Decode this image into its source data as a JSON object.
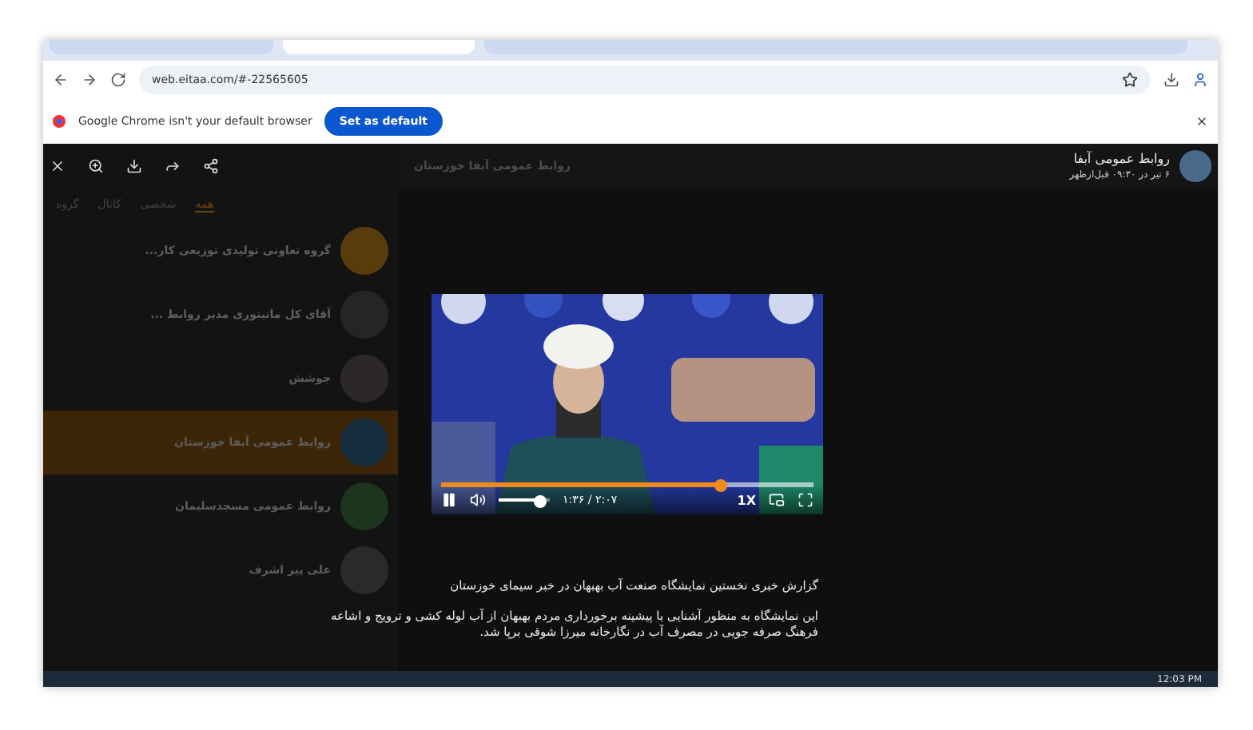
{
  "browser": {
    "tabs": [
      {
        "selected": false
      },
      {
        "selected": true
      },
      {
        "selected": false
      }
    ],
    "url": "web.eitaa.com/#-22565605",
    "banner": {
      "text": "Google Chrome isn't your default browser",
      "button": "Set as default"
    }
  },
  "sidebar": {
    "filters": [
      {
        "label": "همه",
        "selected": true
      },
      {
        "label": "شخصی",
        "selected": false
      },
      {
        "label": "کانال",
        "selected": false
      },
      {
        "label": "گروه",
        "selected": false
      }
    ],
    "chats": [
      {
        "name": "گروه تعاونی تولیدی توزیعی کار...",
        "selected": false
      },
      {
        "name": "آقای کل مانیتوری مدیر روابط ...",
        "selected": false
      },
      {
        "name": "جوشش",
        "selected": false
      },
      {
        "name": "روابط عمومی آبفا خوزستان",
        "selected": true
      },
      {
        "name": "روابط عمومی مسجدسلیمان",
        "selected": false
      },
      {
        "name": "علی پیر اشرف",
        "selected": false
      }
    ]
  },
  "chat": {
    "title": "روابط عمومی آبفا خوزستان"
  },
  "viewer": {
    "author": "روابط عمومی آبفا",
    "date": "۶ تیر در ۰۹:۳۰ قبل‌ازظهر",
    "video": {
      "kind": "picture",
      "playing": true,
      "level": 0.75,
      "volume": {
        "level": 0.8
      },
      "time": "۱:۳۶ / ۲:۰۷",
      "speed": "1X"
    },
    "caption": [
      "گزارش خبری نخستین نمایشگاه صنعت آب بهبهان در خبر سیمای خوزستان",
      "این نمایشگاه به منظور آشنایی با پیشینه برخورداری مردم بهبهان از آب لوله کشی و ترویج و اشاعه فرهنگ صرفه جویی در مصرف آب در نگارخانه میرزا شوقی برپا شد."
    ]
  },
  "taskbar": {
    "time": "12:03 PM"
  }
}
